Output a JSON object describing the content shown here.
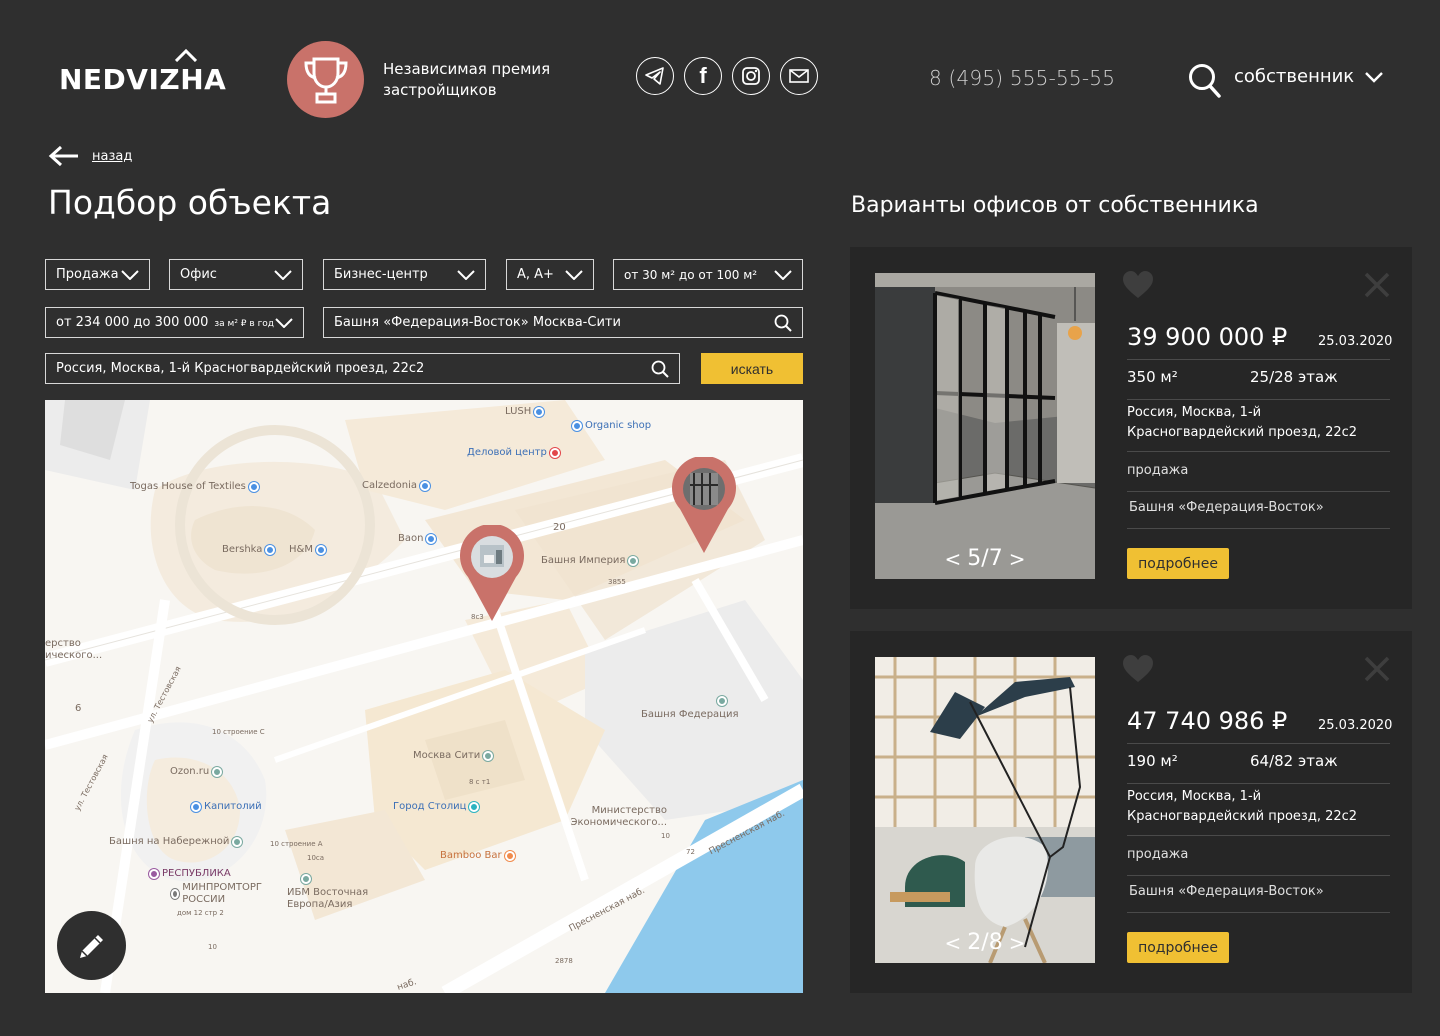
{
  "header": {
    "logo_text": "NEDVIZHA",
    "award_text": "Независимая премия застройщиков",
    "phone": "8 (495) 555-55-55",
    "owner_select_label": "собственник",
    "socials": [
      "telegram-icon",
      "facebook-icon",
      "instagram-icon",
      "mail-icon"
    ]
  },
  "nav": {
    "back_label": "назад"
  },
  "page_title": "Подбор объекта",
  "right_title": "Варианты офисов от собственника",
  "filters": {
    "deal": "Продажа",
    "type": "Офис",
    "building_class": "Бизнес-центр",
    "grade": "А, А+",
    "area": "от 30 м² до от 100 м²",
    "price": "от 234 000 до 300 000",
    "price_unit": "за м² ₽ в год",
    "complex": "Башня «Федерация-Восток»  Москва-Сити",
    "address": "Россия, Москва, 1-й Красногвардейский проезд, 22с2",
    "search_button": "искать"
  },
  "map": {
    "pois": {
      "lush": "LUSH",
      "organic": "Organic shop",
      "delovoy": "Деловой центр",
      "togas": "Togas House of Textiles",
      "calzedonia": "Calzedonia",
      "bershka": "Bershka",
      "hm": "H&M",
      "baon": "Baon",
      "n20": "20",
      "imperia": "Башня Империя",
      "n3855": "3855",
      "n8c3": "8с3",
      "ministry_left": "ерство ического...",
      "n6": "6",
      "ul_test1": "ул. Тестовская",
      "ul_test2": "ул. Тестовская",
      "n10str": "10 строение С",
      "federation": "Башня Федерация",
      "moscow_city": "Москва Сити",
      "n8c1": "8 с т1",
      "ozon": "Ozon.ru",
      "kapitoliy": "Капитолий",
      "gorod_stolits": "Город Столиц",
      "ministry": "Министерство Экономического...",
      "naberezhnaya": "Башня на Набережной",
      "n10strA": "10 строение А",
      "n10ca": "10са",
      "n10": "10",
      "n72": "72",
      "presnenskaya1": "Пресненская наб.",
      "presnenskaya2": "Пресненская наб.",
      "bamboo": "Bamboo Bar",
      "respublika": "РЕСПУБЛИКА",
      "minpromtorg": "МИНПРОМТОРГ РОССИИ",
      "dom12": "дом 12 стр 2",
      "ibm": "ИБМ Восточная Европа/Азия",
      "n10b": "10",
      "n2878": "2878",
      "nab_bottom": "наб."
    }
  },
  "listings": [
    {
      "price": "39 900 000 ₽",
      "date": "25.03.2020",
      "area": "350 м²",
      "floor": "25/28 этаж",
      "address": "Россия, Москва, 1-й Красногвардейский проезд, 22с2",
      "deal": "продажа",
      "building": "Башня «Федерация-Восток»",
      "photo_counter": "5/7",
      "more_label": "подробнее"
    },
    {
      "price": "47 740 986 ₽",
      "date": "25.03.2020",
      "area": "190 м²",
      "floor": "64/82 этаж",
      "address": "Россия, Москва, 1-й Красногвардейский проезд, 22с2",
      "deal": "продажа",
      "building": "Башня «Федерация-Восток»",
      "photo_counter": "2/8",
      "more_label": "подробнее"
    }
  ],
  "colors": {
    "background": "#2f2f2f",
    "card": "#262626",
    "accent_yellow": "#f0c033",
    "accent_terracotta": "#c9726a"
  }
}
